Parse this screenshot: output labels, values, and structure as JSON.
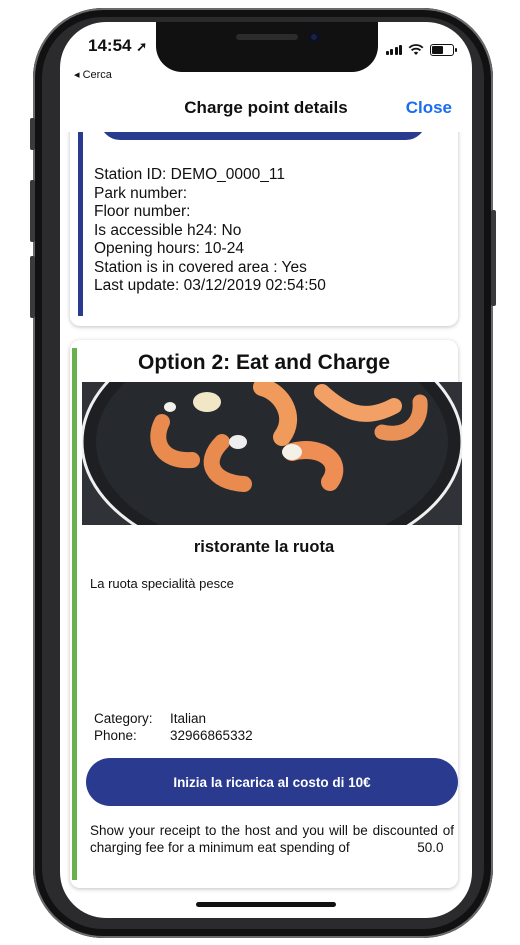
{
  "status_bar": {
    "time": "14:54",
    "location_glyph": "➚",
    "back_label": "◂ Cerca"
  },
  "nav": {
    "title": "Charge point details",
    "close_label": "Close"
  },
  "station_info": {
    "lines": [
      "Station ID: DEMO_0000_11",
      "Park number:",
      "Floor number:",
      "Is accessible h24: No",
      "Opening hours: 10-24",
      "Station is in covered area : Yes",
      "Last update: 03/12/2019 02:54:50"
    ]
  },
  "option": {
    "title": "Option 2: Eat and Charge",
    "restaurant_name": "ristorante  la ruota",
    "description": "La ruota specialità pesce",
    "category_label": "Category:",
    "category_value": "Italian",
    "phone_label": "Phone:",
    "phone_value": "32966865332",
    "cta_label": "Inizia la ricarica al costo di 10€",
    "note_text": "Show your receipt to the host and you will be discounted of charging fee for a minimum eat spending of",
    "min_spend": "50.0"
  },
  "colors": {
    "accent_blue": "#2a3a8f",
    "green_bar": "#6ab04c",
    "link_blue": "#1a6cf0"
  }
}
